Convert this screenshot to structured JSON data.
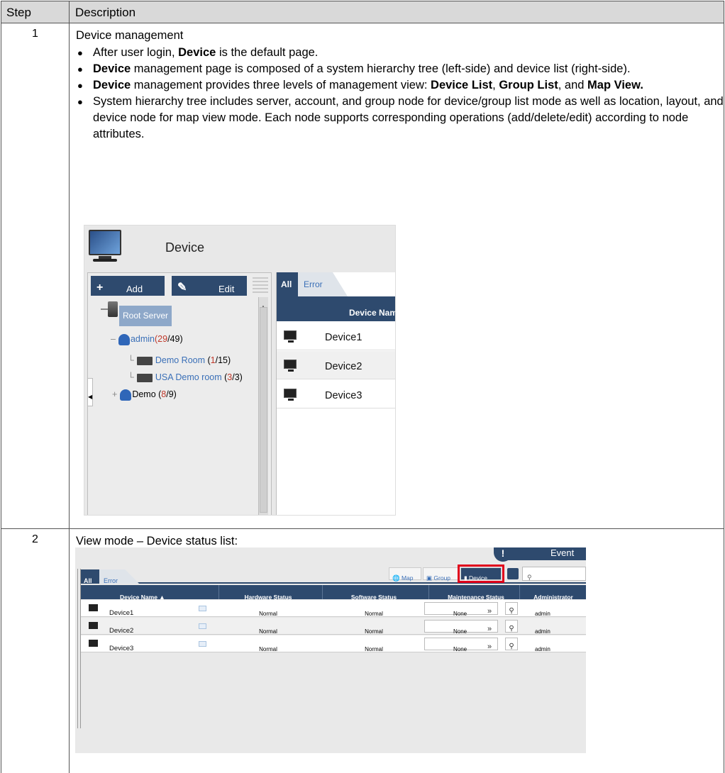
{
  "table": {
    "header": {
      "step": "Step",
      "description": "Description"
    },
    "row1": {
      "step": "1",
      "title": "Device management",
      "b1": {
        "pre": "After user login, ",
        "bold": "Device",
        "post": " is the default page."
      },
      "b2": {
        "bold": "Device",
        "post": " management page is composed of a system hierarchy tree (left-side) and device list (right-side)."
      },
      "b3": {
        "bold": "Device",
        "mid1": " management provides three levels of management view: ",
        "bold2": "Device List",
        "sep": ", ",
        "bold3": "Group List",
        "mid2": ", and ",
        "bold4": "Map View."
      },
      "b4": "System hierarchy tree includes server, account, and group node for device/group list mode as well as location, layout, and device node for map view mode. Each node supports corresponding operations (add/delete/edit) according to node attributes."
    },
    "row2": {
      "step": "2",
      "title": "View mode – Device status list:"
    }
  },
  "screenshot1": {
    "title": "Device",
    "add_label": "Add",
    "edit_label": "Edit",
    "root_server": "Root Server",
    "admin": {
      "name": "admin",
      "open": "(",
      "red": "29",
      "rest": "/49)"
    },
    "demo_room": {
      "name": "Demo Room",
      "open": " (",
      "red": "1",
      "rest": "/15)"
    },
    "usa_room": {
      "name": "USA Demo room",
      "open": " (",
      "red": "3",
      "rest": "/3)"
    },
    "demo": {
      "name": "Demo",
      "open": " (",
      "red": "8",
      "rest": "/9)"
    },
    "tab_all": "All",
    "tab_error": "Error",
    "column_header": "Device Nam",
    "devices": [
      "Device1",
      "Device2",
      "Device3"
    ]
  },
  "screenshot2": {
    "event": "Event",
    "tab_all": "All",
    "tab_error": "Error",
    "map_btn": "Map",
    "group_btn": "Group",
    "device_btn": "Device",
    "search_icon": "search-icon",
    "headers": [
      "Device Name ▲",
      "Hardware Status",
      "Software Status",
      "Maintenance Status",
      "Administrator"
    ],
    "rows": [
      {
        "name": "Device1",
        "hw": "Normal",
        "sw": "Normal",
        "maint": "None",
        "admin": "admin"
      },
      {
        "name": "Device2",
        "hw": "Normal",
        "sw": "Normal",
        "maint": "None",
        "admin": "admin"
      },
      {
        "name": "Device3",
        "hw": "Normal",
        "sw": "Normal",
        "maint": "None",
        "admin": "admin"
      }
    ],
    "highlight_color": "#e0001b",
    "accent_color": "#2e4a6e"
  }
}
